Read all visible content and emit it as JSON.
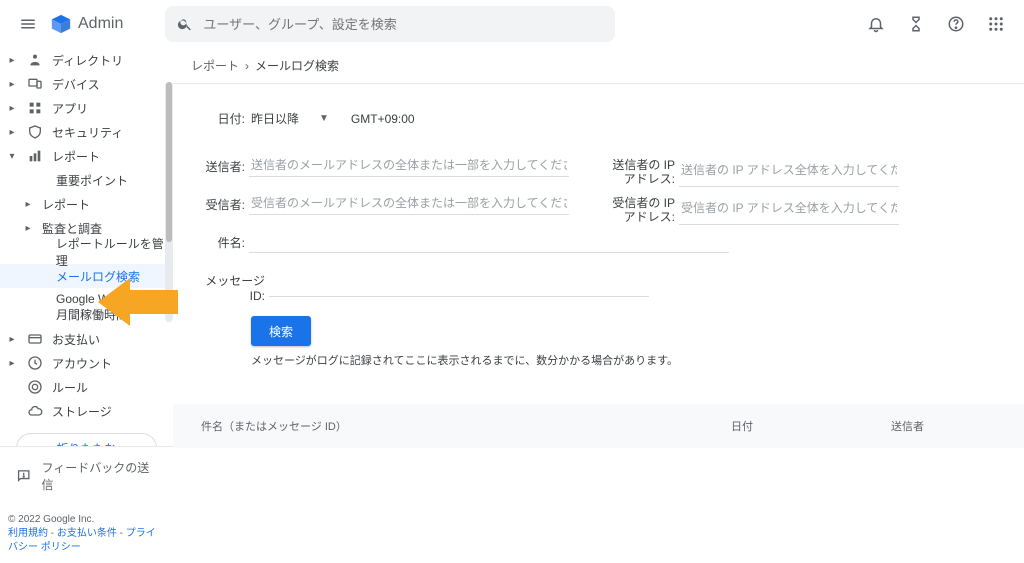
{
  "header": {
    "app_name": "Admin",
    "search_placeholder": "ユーザー、グループ、設定を検索"
  },
  "sidebar": {
    "items": [
      {
        "label": "ディレクトリ",
        "icon": "directory"
      },
      {
        "label": "デバイス",
        "icon": "devices"
      },
      {
        "label": "アプリ",
        "icon": "apps"
      },
      {
        "label": "セキュリティ",
        "icon": "security"
      },
      {
        "label": "レポート",
        "icon": "reports",
        "expanded": true,
        "children": [
          {
            "label": "重要ポイント"
          },
          {
            "label": "レポート",
            "has_children": true
          },
          {
            "label": "監査と調査",
            "has_children": true
          },
          {
            "label": "レポートルールを管理"
          },
          {
            "label": "メールログ検索",
            "active": true
          },
          {
            "label": "Google Workspace アプリの月間稼働時間",
            "truncated": "Google Worksp                の\n月間稼働時間"
          }
        ]
      },
      {
        "label": "お支払い",
        "icon": "billing"
      },
      {
        "label": "アカウント",
        "icon": "account"
      },
      {
        "label": "ルール",
        "icon": "rules"
      },
      {
        "label": "ストレージ",
        "icon": "storage"
      }
    ],
    "fold": "折りたたむ",
    "feedback": "フィードバックの送信",
    "footer": {
      "copyright": "© 2022 Google Inc.",
      "links": [
        "利用規約",
        "お支払い条件",
        "プライバシー ポリシー"
      ]
    }
  },
  "breadcrumb": [
    "レポート",
    "メールログ検索"
  ],
  "form": {
    "date_label": "日付:",
    "date_value": "昨日以降",
    "tz": "GMT+09:00",
    "sender_label": "送信者:",
    "sender_placeholder": "送信者のメールアドレスの全体または一部を入力してください",
    "sender_ip_label": "送信者の IP アドレス:",
    "sender_ip_placeholder": "送信者の IP アドレス全体を入力してください",
    "recipient_label": "受信者:",
    "recipient_placeholder": "受信者のメールアドレスの全体または一部を入力してください",
    "recipient_ip_label": "受信者の IP アドレス:",
    "recipient_ip_placeholder": "受信者の IP アドレス全体を入力してください",
    "subject_label": "件名:",
    "msgid_label": "メッセージ ID:",
    "search_button": "検索",
    "note": "メッセージがログに記録されてここに表示されるまでに、数分かかる場合があります。"
  },
  "table": {
    "col_subject": "件名（またはメッセージ ID）",
    "col_date": "日付",
    "col_sender": "送信者"
  }
}
